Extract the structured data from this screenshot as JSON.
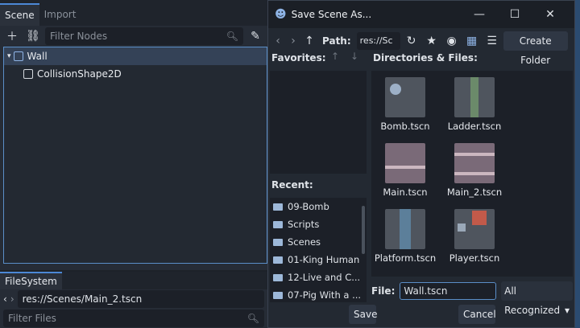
{
  "scene_dock": {
    "tabs": [
      "Scene",
      "Import"
    ],
    "filter_placeholder": "Filter Nodes",
    "tree": [
      {
        "label": "Wall",
        "selected": true
      },
      {
        "label": "CollisionShape2D",
        "selected": false
      }
    ]
  },
  "filesystem": {
    "tab": "FileSystem",
    "path": "res://Scenes/Main_2.tscn",
    "filter_placeholder": "Filter Files"
  },
  "dialog": {
    "title": "Save Scene As...",
    "path_label": "Path:",
    "path_value": "res://Sc",
    "create_folder": "Create Folder",
    "favorites_label": "Favorites:",
    "dirs_label": "Directories & Files:",
    "recent_label": "Recent:",
    "recent": [
      "09-Bomb",
      "Scripts",
      "Scenes",
      "01-King Human",
      "12-Live and C...",
      "07-Pig With a ..."
    ],
    "files": [
      "Bomb.tscn",
      "Ladder.tscn",
      "Main.tscn",
      "Main_2.tscn",
      "Platform.tscn",
      "Player.tscn"
    ],
    "file_label": "File:",
    "file_value": "Wall.tscn",
    "filter_select": "All Recognized",
    "save": "Save",
    "cancel": "Cancel"
  },
  "colors": {
    "accent": "#5a8ec8",
    "panel": "#262c36",
    "field": "#1c2028"
  }
}
